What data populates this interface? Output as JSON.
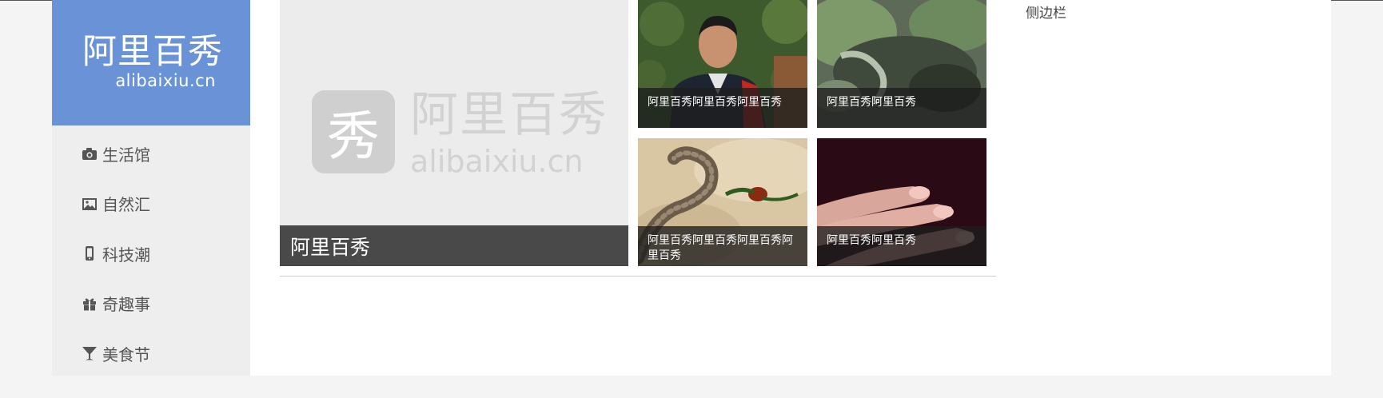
{
  "logo": {
    "title_cn": "阿里百秀",
    "domain": "alibaixiu.cn"
  },
  "nav": {
    "items": [
      {
        "label": "生活馆",
        "icon": "camera-icon"
      },
      {
        "label": "自然汇",
        "icon": "image-icon"
      },
      {
        "label": "科技潮",
        "icon": "phone-icon"
      },
      {
        "label": "奇趣事",
        "icon": "gift-icon"
      },
      {
        "label": "美食节",
        "icon": "cocktail-glass-icon"
      }
    ]
  },
  "hero": {
    "caption": "阿里百秀",
    "watermark": {
      "glyph": "秀",
      "title_cn": "阿里百秀",
      "domain": "alibaixiu.cn"
    }
  },
  "tiles": [
    {
      "caption": "阿里百秀阿里百秀阿里百秀",
      "image": "man-portrait-photo"
    },
    {
      "caption": "阿里百秀阿里百秀",
      "image": "mossy-rock-photo"
    },
    {
      "caption": "阿里百秀阿里百秀阿里百秀阿里百秀",
      "image": "snake-photo"
    },
    {
      "caption": "阿里百秀阿里百秀",
      "image": "fingers-photo"
    }
  ],
  "sidebar": {
    "title": "侧边栏"
  },
  "colors": {
    "logo_bg": "#6a92d6",
    "nav_bg": "#eeeeee",
    "page_bg": "#f4f4f4",
    "caption_bg": "#3c3c3c"
  }
}
